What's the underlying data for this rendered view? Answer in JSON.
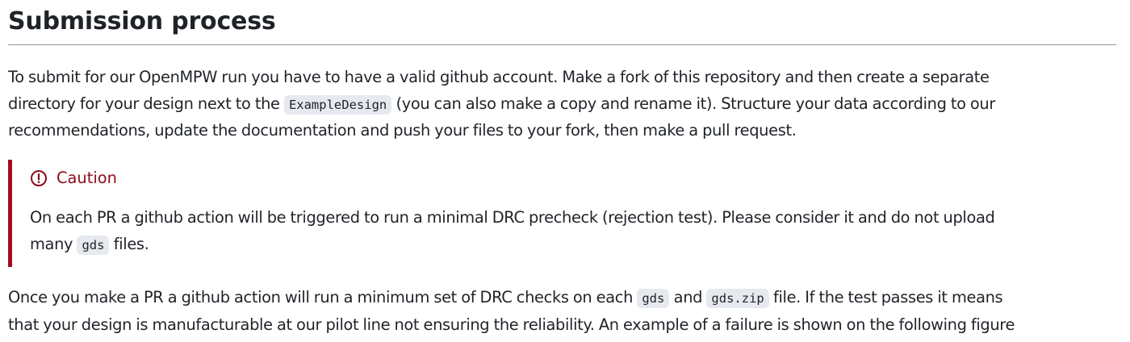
{
  "heading": "Submission process",
  "intro": {
    "line1": "To submit for our OpenMPW run you have to have a valid github account. Make a fork of this repository and then create a separate",
    "line2_before": "directory for your design next to the ",
    "line2_code": "ExampleDesign",
    "line2_after": " (you can also make a copy and rename it). Structure your data according to our",
    "line3": "recommendations, update the documentation and push your files to your fork, then make a pull request."
  },
  "caution": {
    "icon": "alert-circle-icon",
    "title": "Caution",
    "accent_color": "#a00f1f",
    "line1": "On each PR a github action will be triggered to run a minimal DRC precheck (rejection test). Please consider it and do not upload",
    "line2_before": "many ",
    "line2_code": "gds",
    "line2_after": " files."
  },
  "after": {
    "line1_before": "Once you make a PR a github action will run a minimum set of DRC checks on each ",
    "line1_code1": "gds",
    "line1_mid": " and ",
    "line1_code2": "gds.zip",
    "line1_after": " file. If the test passes it means",
    "line2": "that your design is manufacturable at our pilot line not ensuring the reliability. An example of a failure is shown on the following figure"
  }
}
